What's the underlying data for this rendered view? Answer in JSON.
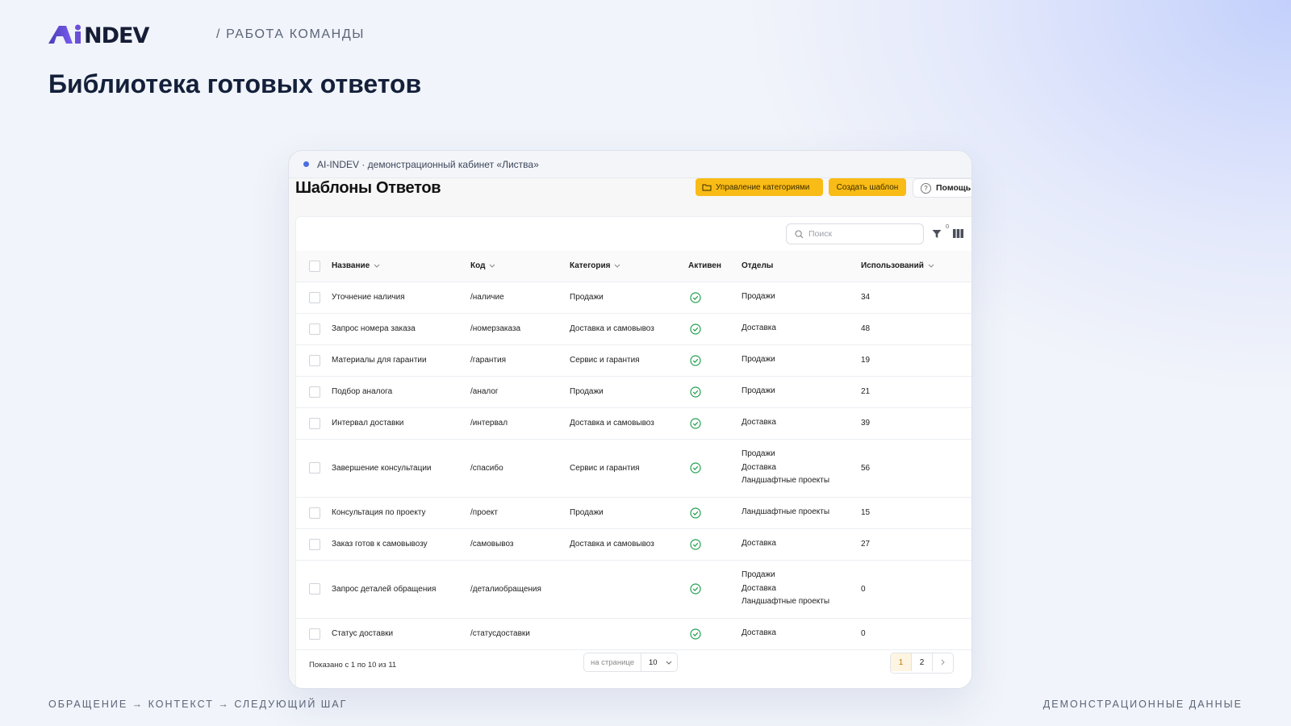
{
  "brand": {
    "logo_text": "AiNDEV"
  },
  "header": {
    "section": "/ РАБОТА КОМАНДЫ",
    "title": "Библиотека готовых ответов"
  },
  "footer": {
    "flow": "ОБРАЩЕНИЕ → КОНТЕКСТ → СЛЕДУЮЩИЙ ШАГ",
    "note": "ДЕМОНСТРАЦИОННЫЕ ДАННЫЕ"
  },
  "window": {
    "title": "AI-INDEV · демонстрационный кабинет «Листва»"
  },
  "app": {
    "title": "Шаблоны Ответов",
    "buttons": {
      "manage_categories": "Управление категориями",
      "create_template": "Создать шаблон",
      "help": "Помощь"
    },
    "search_placeholder": "Поиск",
    "filter_count": "0"
  },
  "table": {
    "columns": {
      "name": "Название",
      "code": "Код",
      "category": "Категория",
      "active": "Активен",
      "departments": "Отделы",
      "usages": "Использований"
    },
    "rows": [
      {
        "name": "Уточнение наличия",
        "code": "/наличие",
        "category": "Продажи",
        "active": true,
        "departments": [
          "Продажи"
        ],
        "usages": "34"
      },
      {
        "name": "Запрос номера заказа",
        "code": "/номерзаказа",
        "category": "Доставка и самовывоз",
        "active": true,
        "departments": [
          "Доставка"
        ],
        "usages": "48"
      },
      {
        "name": "Материалы для гарантии",
        "code": "/гарантия",
        "category": "Сервис и гарантия",
        "active": true,
        "departments": [
          "Продажи"
        ],
        "usages": "19"
      },
      {
        "name": "Подбор аналога",
        "code": "/аналог",
        "category": "Продажи",
        "active": true,
        "departments": [
          "Продажи"
        ],
        "usages": "21"
      },
      {
        "name": "Интервал доставки",
        "code": "/интервал",
        "category": "Доставка и самовывоз",
        "active": true,
        "departments": [
          "Доставка"
        ],
        "usages": "39"
      },
      {
        "name": "Завершение консультации",
        "code": "/спасибо",
        "category": "Сервис и гарантия",
        "active": true,
        "departments": [
          "Продажи",
          "Доставка",
          "Ландшафтные проекты"
        ],
        "usages": "56"
      },
      {
        "name": "Консультация по проекту",
        "code": "/проект",
        "category": "Продажи",
        "active": true,
        "departments": [
          "Ландшафтные проекты"
        ],
        "usages": "15"
      },
      {
        "name": "Заказ готов к самовывозу",
        "code": "/самовывоз",
        "category": "Доставка и самовывоз",
        "active": true,
        "departments": [
          "Доставка"
        ],
        "usages": "27"
      },
      {
        "name": "Запрос деталей обращения",
        "code": "/деталиобращения",
        "category": "",
        "active": true,
        "departments": [
          "Продажи",
          "Доставка",
          "Ландшафтные проекты"
        ],
        "usages": "0"
      },
      {
        "name": "Статус доставки",
        "code": "/статусдоставки",
        "category": "",
        "active": true,
        "departments": [
          "Доставка"
        ],
        "usages": "0"
      }
    ]
  },
  "pagination": {
    "info": "Показано с 1 по 10 из 11",
    "per_page_label": "на странице",
    "per_page_value": "10",
    "pages": [
      "1",
      "2"
    ],
    "current_page": "1"
  },
  "colors": {
    "accent_yellow": "#f9bb16",
    "active_green": "#22a050",
    "brand_purple": "#6b4fd8",
    "brand_dark": "#161d36"
  }
}
